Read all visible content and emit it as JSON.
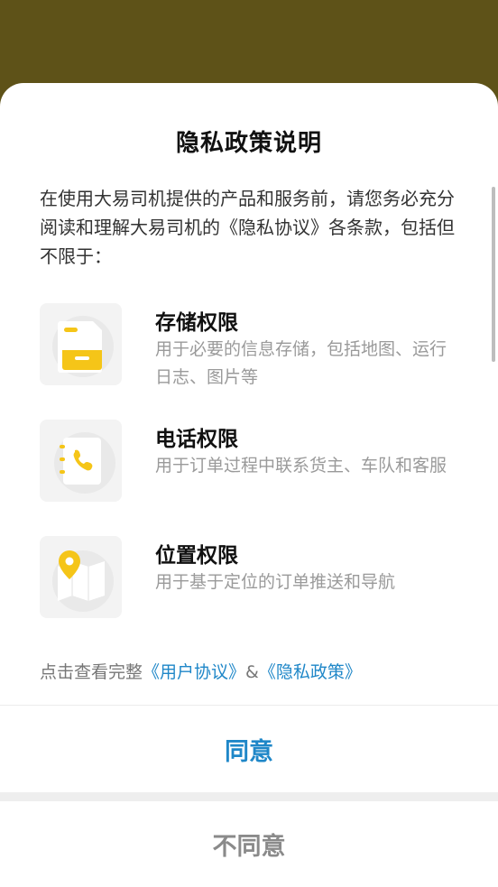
{
  "dialog": {
    "title": "隐私政策说明",
    "intro": "在使用大易司机提供的产品和服务前，请您务必充分阅读和理解大易司机的《隐私协议》各条款，包括但不限于：",
    "permissions": [
      {
        "icon": "storage-icon",
        "title": "存储权限",
        "description": "用于必要的信息存储，包括地图、运行日志、图片等"
      },
      {
        "icon": "phone-icon",
        "title": "电话权限",
        "description": "用于订单过程中联系货主、车队和客服"
      },
      {
        "icon": "location-map-icon",
        "title": "位置权限",
        "description": "用于基于定位的订单推送和导航"
      }
    ],
    "links": {
      "prefix": "点击查看完整",
      "user_agreement": "《用户协议》",
      "separator": "&",
      "privacy_policy": "《隐私政策》"
    },
    "agree_label": "同意",
    "disagree_label": "不同意"
  },
  "colors": {
    "backdrop": "#5e5218",
    "accent": "#1f87c8",
    "icon_yellow": "#f5c518"
  }
}
